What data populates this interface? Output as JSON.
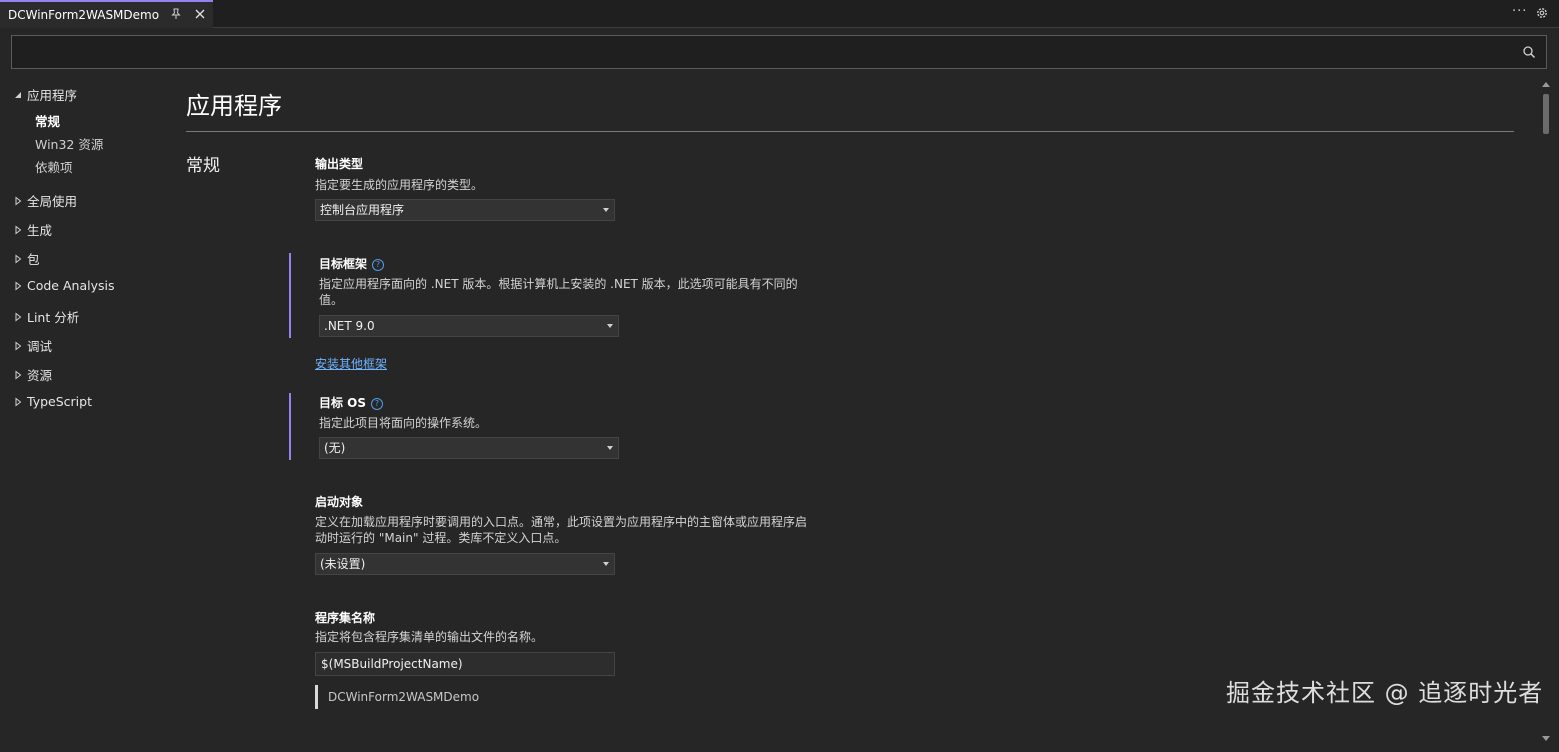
{
  "tab": {
    "title": "DCWinForm2WASMDemo",
    "pin_icon": "pin-icon",
    "close_icon": "close-icon"
  },
  "toolbar": {
    "more_icon": "more-icon",
    "more_label": "···",
    "settings_icon": "gear-icon"
  },
  "search": {
    "value": "",
    "placeholder": "",
    "icon": "search-icon"
  },
  "nav": {
    "application": {
      "label": "应用程序",
      "expanded": true
    },
    "sub_items": [
      {
        "label": "常规",
        "active": true
      },
      {
        "label": "Win32 资源",
        "active": false
      },
      {
        "label": "依赖项",
        "active": false
      }
    ],
    "collapsed": [
      {
        "label": "全局使用"
      },
      {
        "label": "生成"
      },
      {
        "label": "包"
      },
      {
        "label": "Code Analysis"
      },
      {
        "label": "Lint 分析"
      },
      {
        "label": "调试"
      },
      {
        "label": "资源"
      },
      {
        "label": "TypeScript"
      }
    ]
  },
  "page": {
    "title": "应用程序",
    "section": "常规"
  },
  "props": {
    "output_type": {
      "label": "输出类型",
      "desc": "指定要生成的应用程序的类型。",
      "value": "控制台应用程序"
    },
    "target_framework": {
      "label": "目标框架",
      "desc": "指定应用程序面向的 .NET 版本。根据计算机上安装的 .NET 版本，此选项可能具有不同的值。",
      "value": ".NET 9.0",
      "link": "安装其他框架"
    },
    "target_os": {
      "label": "目标 OS",
      "desc": "指定此项目将面向的操作系统。",
      "value": "(无)"
    },
    "startup_object": {
      "label": "启动对象",
      "desc": "定义在加载应用程序时要调用的入口点。通常，此项设置为应用程序中的主窗体或应用程序启动时运行的 \"Main\" 过程。类库不定义入口点。",
      "value": "(未设置)"
    },
    "assembly_name": {
      "label": "程序集名称",
      "desc": "指定将包含程序集清单的输出文件的名称。",
      "value": "$(MSBuildProjectName)",
      "resolved": "DCWinForm2WASMDemo"
    }
  },
  "watermark": "掘金技术社区 @ 追逐时光者",
  "colors": {
    "accent": "#9184ee",
    "link": "#6fb3ff",
    "background": "#262626"
  }
}
